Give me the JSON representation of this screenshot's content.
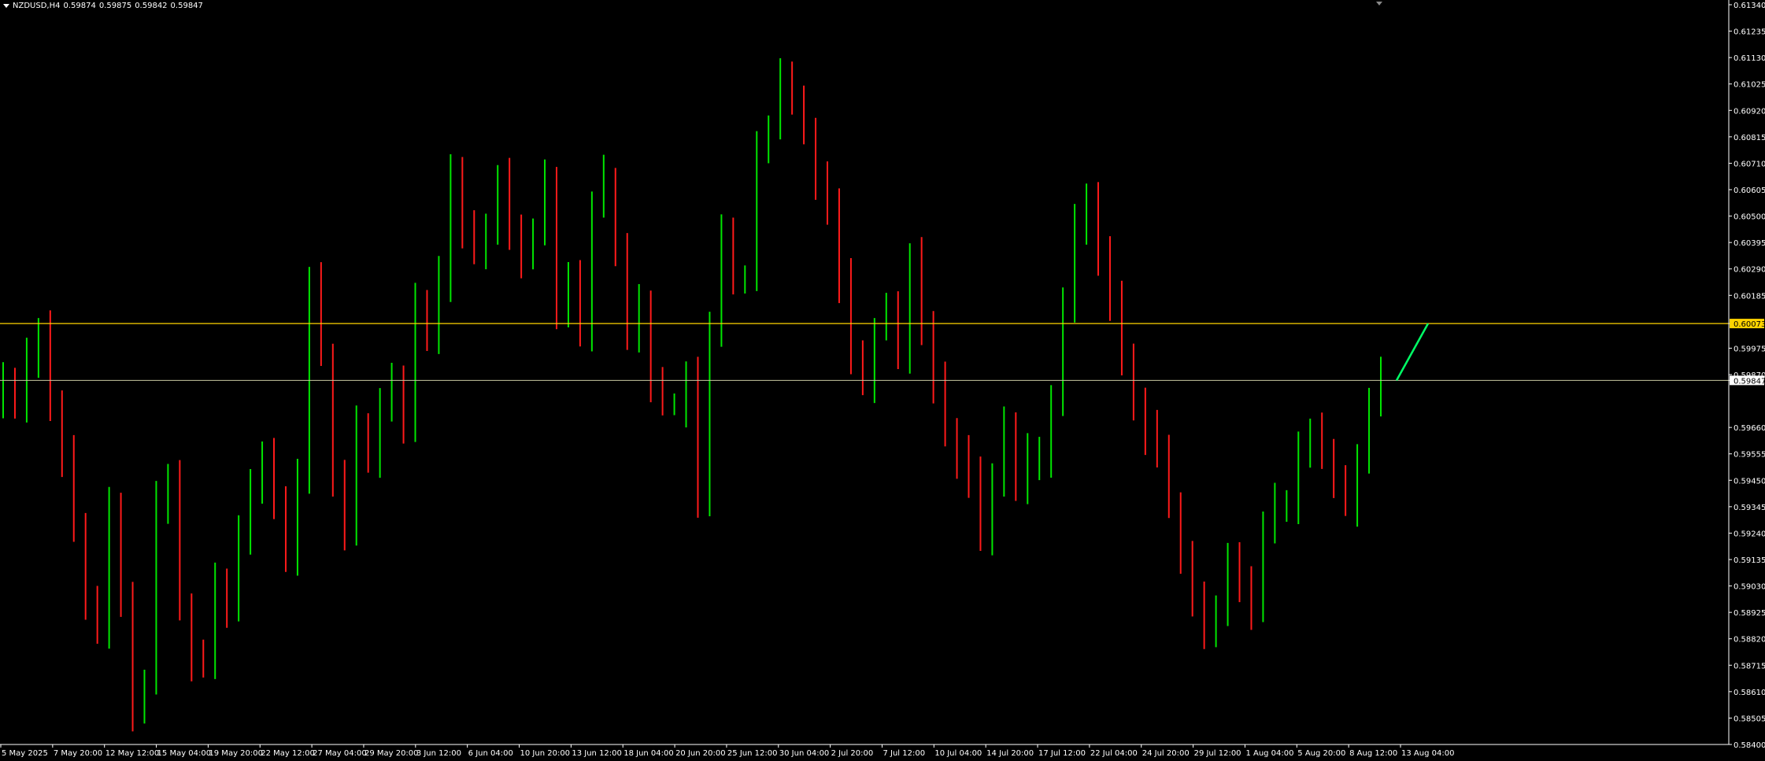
{
  "header": {
    "symbol": "NZDUSD,H4",
    "open": "0.59874",
    "high": "0.59875",
    "low": "0.59842",
    "close": "0.59847"
  },
  "colors": {
    "background": "#000000",
    "axis": "#ffffff",
    "bull": "#00e600",
    "bear": "#ff1a1a",
    "level_line": "#ffd400",
    "bid_line": "#c8c8a0",
    "projection": "#00ff66",
    "level_label_bg": "#ffd400",
    "bid_label_bg": "#ffffff"
  },
  "chart_data": {
    "type": "candlestick",
    "symbol": "NZDUSD",
    "timeframe": "H4",
    "ylim": [
      0.584,
      0.6134
    ],
    "y_ticks": [
      "0.61340",
      "0.61235",
      "0.61130",
      "0.61025",
      "0.60920",
      "0.60815",
      "0.60710",
      "0.60605",
      "0.60500",
      "0.60395",
      "0.60290",
      "0.60185",
      "0.60073",
      "0.59975",
      "0.59870",
      "0.59847",
      "0.59660",
      "0.59555",
      "0.59450",
      "0.59345",
      "0.59240",
      "0.59135",
      "0.59030",
      "0.58925",
      "0.58820",
      "0.58715",
      "0.58610",
      "0.58505",
      "0.58400"
    ],
    "x_labels": [
      "5 May 2025",
      "7 May 20:00",
      "12 May 12:00",
      "15 May 04:00",
      "19 May 20:00",
      "22 May 12:00",
      "27 May 04:00",
      "29 May 20:00",
      "3 Jun 12:00",
      "6 Jun 04:00",
      "10 Jun 20:00",
      "13 Jun 12:00",
      "18 Jun 04:00",
      "20 Jun 20:00",
      "25 Jun 12:00",
      "30 Jun 04:00",
      "2 Jul 20:00",
      "7 Jul 12:00",
      "10 Jul 04:00",
      "14 Jul 20:00",
      "17 Jul 12:00",
      "22 Jul 04:00",
      "24 Jul 20:00",
      "29 Jul 12:00",
      "1 Aug 04:00",
      "5 Aug 20:00",
      "8 Aug 12:00",
      "13 Aug 04:00"
    ],
    "closes": [
      0.5985,
      0.5975,
      0.5995,
      0.6005,
      0.5975,
      0.5955,
      0.5925,
      0.5895,
      0.5885,
      0.5935,
      0.5895,
      0.5855,
      0.5865,
      0.5935,
      0.5945,
      0.5895,
      0.5875,
      0.5872,
      0.5905,
      0.5895,
      0.5925,
      0.5945,
      0.5955,
      0.5935,
      0.5915,
      0.5945,
      0.6025,
      0.5995,
      0.5945,
      0.5925,
      0.5965,
      0.5955,
      0.5975,
      0.5985,
      0.5965,
      0.6015,
      0.6005,
      0.6025,
      0.6065,
      0.6045,
      0.6035,
      0.6045,
      0.6065,
      0.6045,
      0.6035,
      0.6045,
      0.6065,
      0.6015,
      0.6025,
      0.6005,
      0.6055,
      0.6065,
      0.6035,
      0.6005,
      0.6015,
      0.5985,
      0.5975,
      0.5975,
      0.5985,
      0.5935,
      0.6005,
      0.6045,
      0.6025,
      0.6025,
      0.6075,
      0.6085,
      0.6105,
      0.6095,
      0.6085,
      0.6065,
      0.6055,
      0.6025,
      0.5995,
      0.5985,
      0.6005,
      0.6015,
      0.5995,
      0.6035,
      0.6005,
      0.5985,
      0.5965,
      0.5955,
      0.5945,
      0.5925,
      0.5945,
      0.5965,
      0.5945,
      0.5955,
      0.5955,
      0.5975,
      0.6015,
      0.6045,
      0.6055,
      0.6035,
      0.6015,
      0.5995,
      0.5975,
      0.5965,
      0.5955,
      0.5935,
      0.5915,
      0.5895,
      0.5885,
      0.5895,
      0.5915,
      0.5905,
      0.5895,
      0.5925,
      0.5935,
      0.5935,
      0.5955,
      0.5965,
      0.5955,
      0.5945,
      0.5935,
      0.5955,
      0.5975,
      0.59847
    ],
    "key_levels": [
      {
        "price": 0.60073,
        "label": "0.60073"
      },
      {
        "price": 0.59847,
        "label": "0.59847"
      }
    ],
    "projection": {
      "from_price": 0.59847,
      "to_price": 0.60073
    }
  }
}
